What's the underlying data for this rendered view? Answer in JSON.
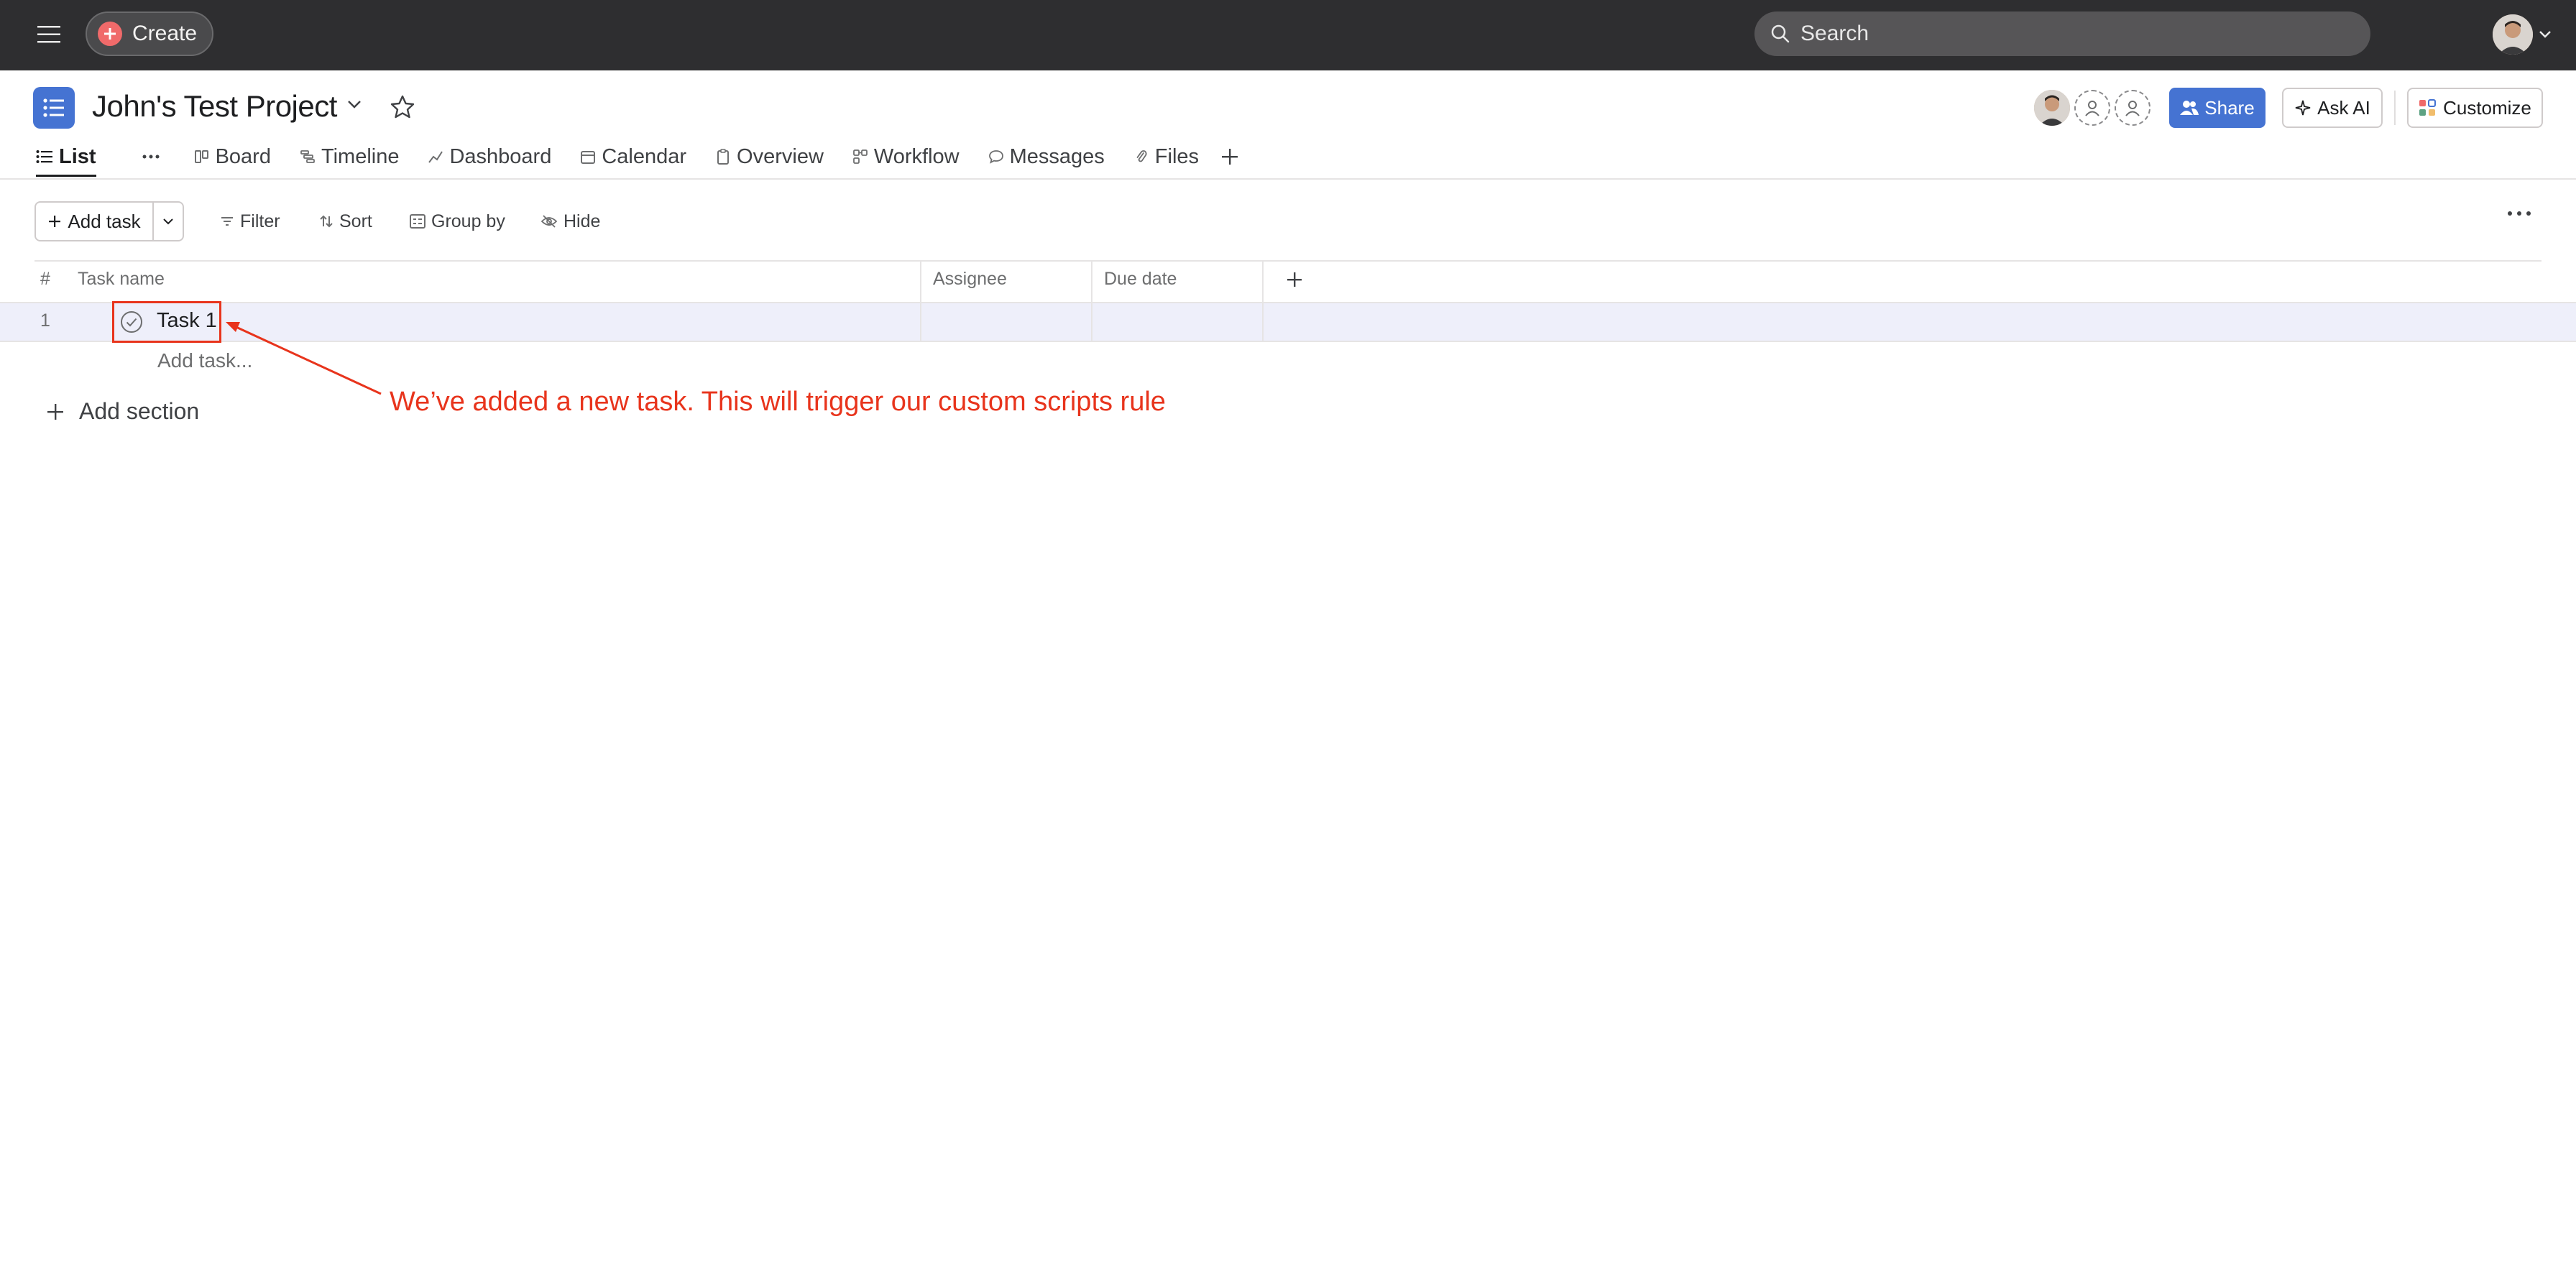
{
  "topbar": {
    "create_label": "Create",
    "search_placeholder": "Search"
  },
  "project": {
    "title": "John's Test Project"
  },
  "header_actions": {
    "share_label": "Share",
    "ask_ai_label": "Ask AI",
    "customize_label": "Customize"
  },
  "tabs": [
    {
      "label": "List",
      "icon": "list-icon",
      "active": true
    },
    {
      "label": "Board",
      "icon": "board-icon"
    },
    {
      "label": "Timeline",
      "icon": "timeline-icon"
    },
    {
      "label": "Dashboard",
      "icon": "dashboard-icon"
    },
    {
      "label": "Calendar",
      "icon": "calendar-icon"
    },
    {
      "label": "Overview",
      "icon": "overview-icon"
    },
    {
      "label": "Workflow",
      "icon": "workflow-icon"
    },
    {
      "label": "Messages",
      "icon": "messages-icon"
    },
    {
      "label": "Files",
      "icon": "files-icon"
    }
  ],
  "toolbar": {
    "add_task_label": "Add task",
    "filter_label": "Filter",
    "sort_label": "Sort",
    "group_by_label": "Group by",
    "hide_label": "Hide"
  },
  "table": {
    "columns": [
      "#",
      "Task name",
      "Assignee",
      "Due date"
    ],
    "rows": [
      {
        "num": "1",
        "name": "Task 1",
        "assignee": "",
        "due_date": ""
      }
    ],
    "add_task_placeholder": "Add task...",
    "add_section_label": "Add section"
  },
  "annotation": {
    "text": "We’ve added a new task. This will trigger our custom scripts rule",
    "color": "#e8341c"
  },
  "colors": {
    "topbar_bg": "#2e2e30",
    "accent_blue": "#4573d2",
    "create_red": "#f06a6a",
    "row_highlight": "#eeeffa"
  }
}
